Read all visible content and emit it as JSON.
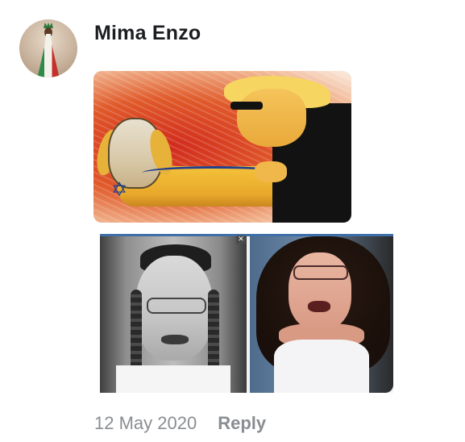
{
  "comment": {
    "author_name": "Mima Enzo",
    "timestamp": "12 May 2020",
    "reply_label": "Reply"
  },
  "icons": {
    "close": "close-icon"
  },
  "colors": {
    "author_name": "#1c1e21",
    "meta_text": "#8a8d91",
    "collage_border": "#3f6fa8"
  }
}
